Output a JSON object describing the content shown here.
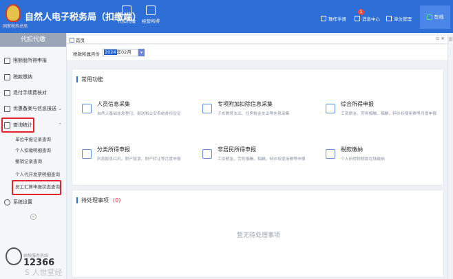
{
  "header": {
    "logo_sub": "国家税务总局",
    "title": "自然人电子税务局（扣缴端）",
    "tools": [
      {
        "label": "代扣代缴",
        "icon": "withholding-icon"
      },
      {
        "label": "经营所得",
        "icon": "business-income-icon"
      }
    ],
    "links": [
      {
        "label": "操作手册",
        "icon": "manual-icon"
      },
      {
        "label": "消息中心",
        "icon": "message-icon"
      },
      {
        "label": "单位管理",
        "icon": "unit-icon"
      }
    ],
    "message_badge": "1",
    "online_label": "在线"
  },
  "sidebar": {
    "title": "代扣代缴",
    "items": [
      {
        "label": "限额股所得申报",
        "icon": "chart-icon"
      },
      {
        "label": "税款缴纳",
        "icon": "receipt-icon"
      },
      {
        "label": "退付手续费核对",
        "icon": "document-icon"
      },
      {
        "label": "优惠备案与信息报送",
        "icon": "folder-icon"
      },
      {
        "label": "查询统计",
        "icon": "stats-icon"
      }
    ],
    "subitems": [
      "单位申报记录查询",
      "个人扣缴明细查询",
      "撤销记录查询",
      "个人代开发票明细查询",
      "员工汇算申报状态查询"
    ],
    "settings_label": "系统设置",
    "hotline_label": "纳税服务热线",
    "hotline_number": "12366",
    "watermark": "S 人世堂经"
  },
  "tabbar": {
    "home_tab": "首页",
    "close": "▫ ×"
  },
  "filter": {
    "label": "税款所属月份",
    "value_year": "2024",
    "value_rest": "年02月"
  },
  "common": {
    "title": "常用功能",
    "functions": [
      {
        "name": "人员信息采集",
        "desc": "自然人基础信息登记、报送和公安系统身份验证",
        "icon": "person-card-icon"
      },
      {
        "name": "专项附加扣除信息采集",
        "desc": "子女教育支出、住房租金支出等信息采集",
        "icon": "id-card-icon"
      },
      {
        "name": "综合所得申报",
        "desc": "工资薪金、劳务报酬、稿酬、特许权使用费等月度申报",
        "icon": "income-icon"
      },
      {
        "name": "分类所得申报",
        "desc": "利息股息红利、财产租赁、财产转让等月度申报",
        "icon": "edit-icon"
      },
      {
        "name": "非居民所得申报",
        "desc": "工资薪金、劳务报酬、稿酬、特许权使用费等申报",
        "icon": "edit-icon"
      },
      {
        "name": "税款缴纳",
        "desc": "个人所得税税款在线缴纳",
        "icon": "payment-icon"
      }
    ]
  },
  "pending": {
    "title": "待处理事项",
    "count": "(0)",
    "empty": "暂无待处理事项"
  }
}
